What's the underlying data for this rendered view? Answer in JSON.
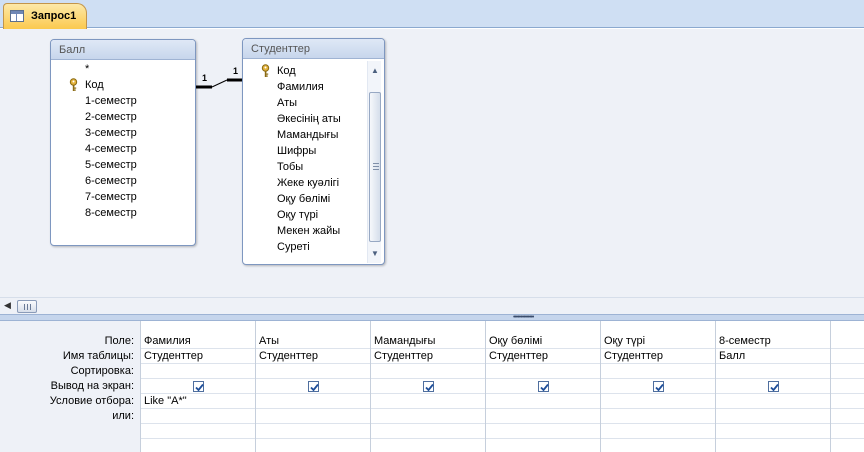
{
  "tab": {
    "title": "Запрос1",
    "icon": "query-icon"
  },
  "tables": {
    "ball": {
      "title": "Балл",
      "fields": [
        "*",
        "Код",
        "1-семестр",
        "2-семестр",
        "3-семестр",
        "4-семестр",
        "5-семестр",
        "6-семестр",
        "7-семестр",
        "8-семестр"
      ],
      "key_field": "Код"
    },
    "students": {
      "title": "Студенттер",
      "fields": [
        "Код",
        "Фамилия",
        "Аты",
        "Әкесінің аты",
        "Мамандығы",
        "Шифры",
        "Тобы",
        "Жеке куәлігі",
        "Оқу бөлімі",
        "Оқу түрі",
        "Мекен жайы",
        "Суреті"
      ],
      "key_field": "Код"
    }
  },
  "relationship": {
    "left_label": "1",
    "right_label": "1"
  },
  "grid": {
    "row_labels": [
      "Поле:",
      "Имя таблицы:",
      "Сортировка:",
      "Вывод на экран:",
      "Условие отбора:",
      "или:"
    ],
    "columns": [
      {
        "field": "Фамилия",
        "table": "Студенттер",
        "sort": "",
        "show": true,
        "criteria": "Like \"A*\"",
        "or": ""
      },
      {
        "field": "Аты",
        "table": "Студенттер",
        "sort": "",
        "show": true,
        "criteria": "",
        "or": ""
      },
      {
        "field": "Мамандығы",
        "table": "Студенттер",
        "sort": "",
        "show": true,
        "criteria": "",
        "or": ""
      },
      {
        "field": "Оқу бөлімі",
        "table": "Студенттер",
        "sort": "",
        "show": true,
        "criteria": "",
        "or": ""
      },
      {
        "field": "Оқу түрі",
        "table": "Студенттер",
        "sort": "",
        "show": true,
        "criteria": "",
        "or": ""
      },
      {
        "field": "8-семестр",
        "table": "Балл",
        "sort": "",
        "show": true,
        "criteria": "",
        "or": ""
      }
    ]
  },
  "colors": {
    "tab_active": "#fbc94e",
    "design_bg": "#eef1f7",
    "check": "#1f4f9a"
  }
}
